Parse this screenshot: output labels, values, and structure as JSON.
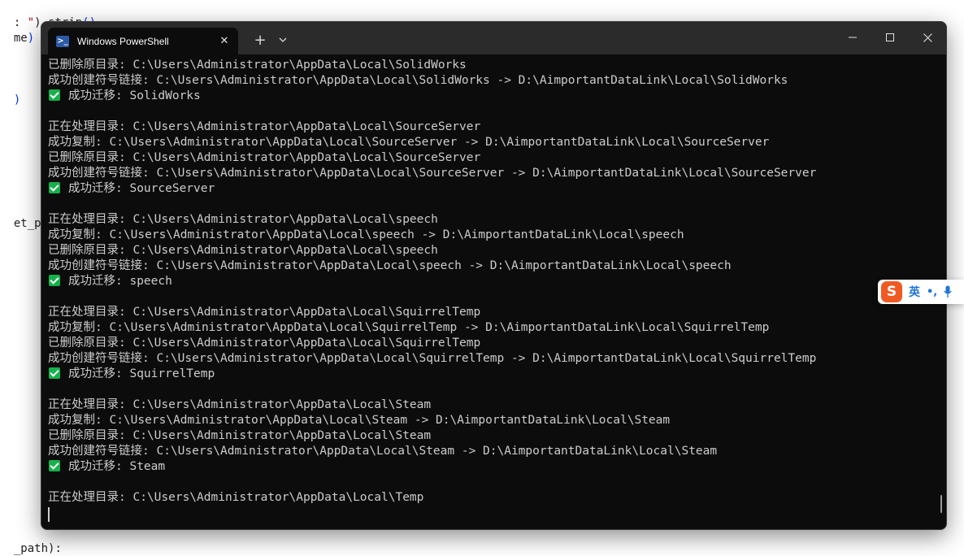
{
  "background_editor": {
    "lines": [
      {
        "pre": ": ",
        "str": "\"",
        "post": ").strip",
        "paren": "()"
      },
      {
        "pre": "me",
        "str": "",
        "post": "",
        "paren": ")"
      },
      {
        "pre": "",
        "str": "",
        "post": "",
        "paren": ")"
      },
      {
        "pre": "et_pa",
        "str": "",
        "post": "",
        "paren": ""
      },
      {
        "pre": "_path",
        "str": "",
        "post": "):",
        "paren": ""
      }
    ]
  },
  "window": {
    "tab_title": "Windows PowerShell",
    "tab_icon": "powershell-icon",
    "tab_close": "✕",
    "new_tab": "+",
    "tab_menu": "chevron-down-icon",
    "accent": "#0c0c0c",
    "lines": [
      {
        "text": "已删除原目录: C:\\Users\\Administrator\\AppData\\Local\\SolidWorks"
      },
      {
        "text": "成功创建符号链接: C:\\Users\\Administrator\\AppData\\Local\\SolidWorks -> D:\\AimportantDataLink\\Local\\SolidWorks"
      },
      {
        "text": "成功迁移: SolidWorks",
        "check": true
      },
      {
        "text": ""
      },
      {
        "text": "正在处理目录: C:\\Users\\Administrator\\AppData\\Local\\SourceServer"
      },
      {
        "text": "成功复制: C:\\Users\\Administrator\\AppData\\Local\\SourceServer -> D:\\AimportantDataLink\\Local\\SourceServer"
      },
      {
        "text": "已删除原目录: C:\\Users\\Administrator\\AppData\\Local\\SourceServer"
      },
      {
        "text": "成功创建符号链接: C:\\Users\\Administrator\\AppData\\Local\\SourceServer -> D:\\AimportantDataLink\\Local\\SourceServer"
      },
      {
        "text": "成功迁移: SourceServer",
        "check": true
      },
      {
        "text": ""
      },
      {
        "text": "正在处理目录: C:\\Users\\Administrator\\AppData\\Local\\speech"
      },
      {
        "text": "成功复制: C:\\Users\\Administrator\\AppData\\Local\\speech -> D:\\AimportantDataLink\\Local\\speech"
      },
      {
        "text": "已删除原目录: C:\\Users\\Administrator\\AppData\\Local\\speech"
      },
      {
        "text": "成功创建符号链接: C:\\Users\\Administrator\\AppData\\Local\\speech -> D:\\AimportantDataLink\\Local\\speech"
      },
      {
        "text": "成功迁移: speech",
        "check": true
      },
      {
        "text": ""
      },
      {
        "text": "正在处理目录: C:\\Users\\Administrator\\AppData\\Local\\SquirrelTemp"
      },
      {
        "text": "成功复制: C:\\Users\\Administrator\\AppData\\Local\\SquirrelTemp -> D:\\AimportantDataLink\\Local\\SquirrelTemp"
      },
      {
        "text": "已删除原目录: C:\\Users\\Administrator\\AppData\\Local\\SquirrelTemp"
      },
      {
        "text": "成功创建符号链接: C:\\Users\\Administrator\\AppData\\Local\\SquirrelTemp -> D:\\AimportantDataLink\\Local\\SquirrelTemp"
      },
      {
        "text": "成功迁移: SquirrelTemp",
        "check": true
      },
      {
        "text": ""
      },
      {
        "text": "正在处理目录: C:\\Users\\Administrator\\AppData\\Local\\Steam"
      },
      {
        "text": "成功复制: C:\\Users\\Administrator\\AppData\\Local\\Steam -> D:\\AimportantDataLink\\Local\\Steam"
      },
      {
        "text": "已删除原目录: C:\\Users\\Administrator\\AppData\\Local\\Steam"
      },
      {
        "text": "成功创建符号链接: C:\\Users\\Administrator\\AppData\\Local\\Steam -> D:\\AimportantDataLink\\Local\\Steam"
      },
      {
        "text": "成功迁移: Steam",
        "check": true
      },
      {
        "text": ""
      },
      {
        "text": "正在处理目录: C:\\Users\\Administrator\\AppData\\Local\\Temp"
      }
    ]
  },
  "ime": {
    "logo": "S",
    "language": "英",
    "punct": "•,",
    "mic_icon": "microphone-icon",
    "accent": "#1e73d8"
  }
}
